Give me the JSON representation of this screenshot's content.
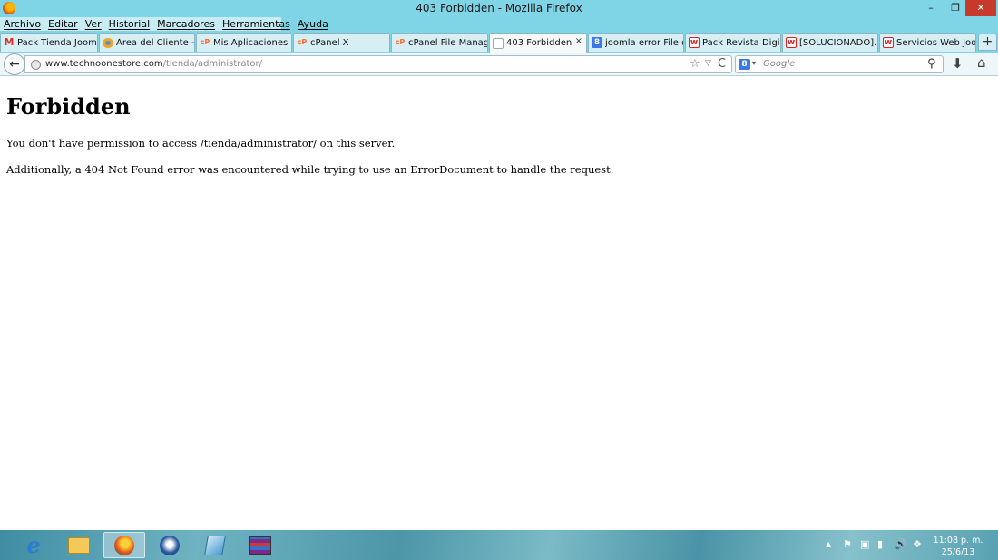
{
  "window": {
    "title": "403 Forbidden - Mozilla Firefox",
    "controls": {
      "minimize": "–",
      "maximize": "❐",
      "close": "✕"
    }
  },
  "menu": {
    "items": [
      "Archivo",
      "Editar",
      "Ver",
      "Historial",
      "Marcadores",
      "Herramientas",
      "Ayuda"
    ]
  },
  "tabs": [
    {
      "label": "Pack Tienda Joom...",
      "icon": "gmail-icon"
    },
    {
      "label": "Área del Cliente - ...",
      "icon": "client-area-icon"
    },
    {
      "label": "Mis Aplicaciones (...",
      "icon": "cpanel-icon"
    },
    {
      "label": "cPanel X",
      "icon": "cpanel-icon"
    },
    {
      "label": "cPanel File Manag...",
      "icon": "cpanel-icon"
    },
    {
      "label": "403 Forbidden",
      "icon": "blank-page-icon",
      "active": true,
      "close": "×"
    },
    {
      "label": "joomla error File d...",
      "icon": "google-icon"
    },
    {
      "label": "Pack Revista Digit...",
      "icon": "w-icon"
    },
    {
      "label": "[SOLUCIONADO]...",
      "icon": "w-icon"
    },
    {
      "label": "Servicios Web Joo...",
      "icon": "w-icon"
    }
  ],
  "new_tab": "+",
  "nav": {
    "back": "←",
    "url_domain": "www.technoonestore.com",
    "url_path": "/tienda/administrator/",
    "star": "☆",
    "dropdown": "▽",
    "reload": "C",
    "search_engine": "8",
    "search_placeholder": "Google",
    "magnifier": "⚲",
    "download": "⬇",
    "home": "⌂"
  },
  "page": {
    "heading": "Forbidden",
    "message": "You don't have permission to access /tienda/administrator/ on this server.",
    "additional": "Additionally, a 404 Not Found error was encountered while trying to use an ErrorDocument to handle the request."
  },
  "taskbar": {
    "apps": [
      "internet-explorer",
      "file-explorer",
      "firefox",
      "thunderbird",
      "notepad",
      "winrar"
    ],
    "ie_glyph": "e",
    "tray": {
      "up": "▲",
      "flag": "⚑",
      "monitor": "▣",
      "signal": "▮",
      "volume": "🔊",
      "app": "❖"
    },
    "clock_time": "11:08 p. m.",
    "clock_date": "25/6/13"
  },
  "colors": {
    "titlebar": "#7fd4e6",
    "close_button": "#c7392b",
    "taskbar": "#4c96a8"
  }
}
